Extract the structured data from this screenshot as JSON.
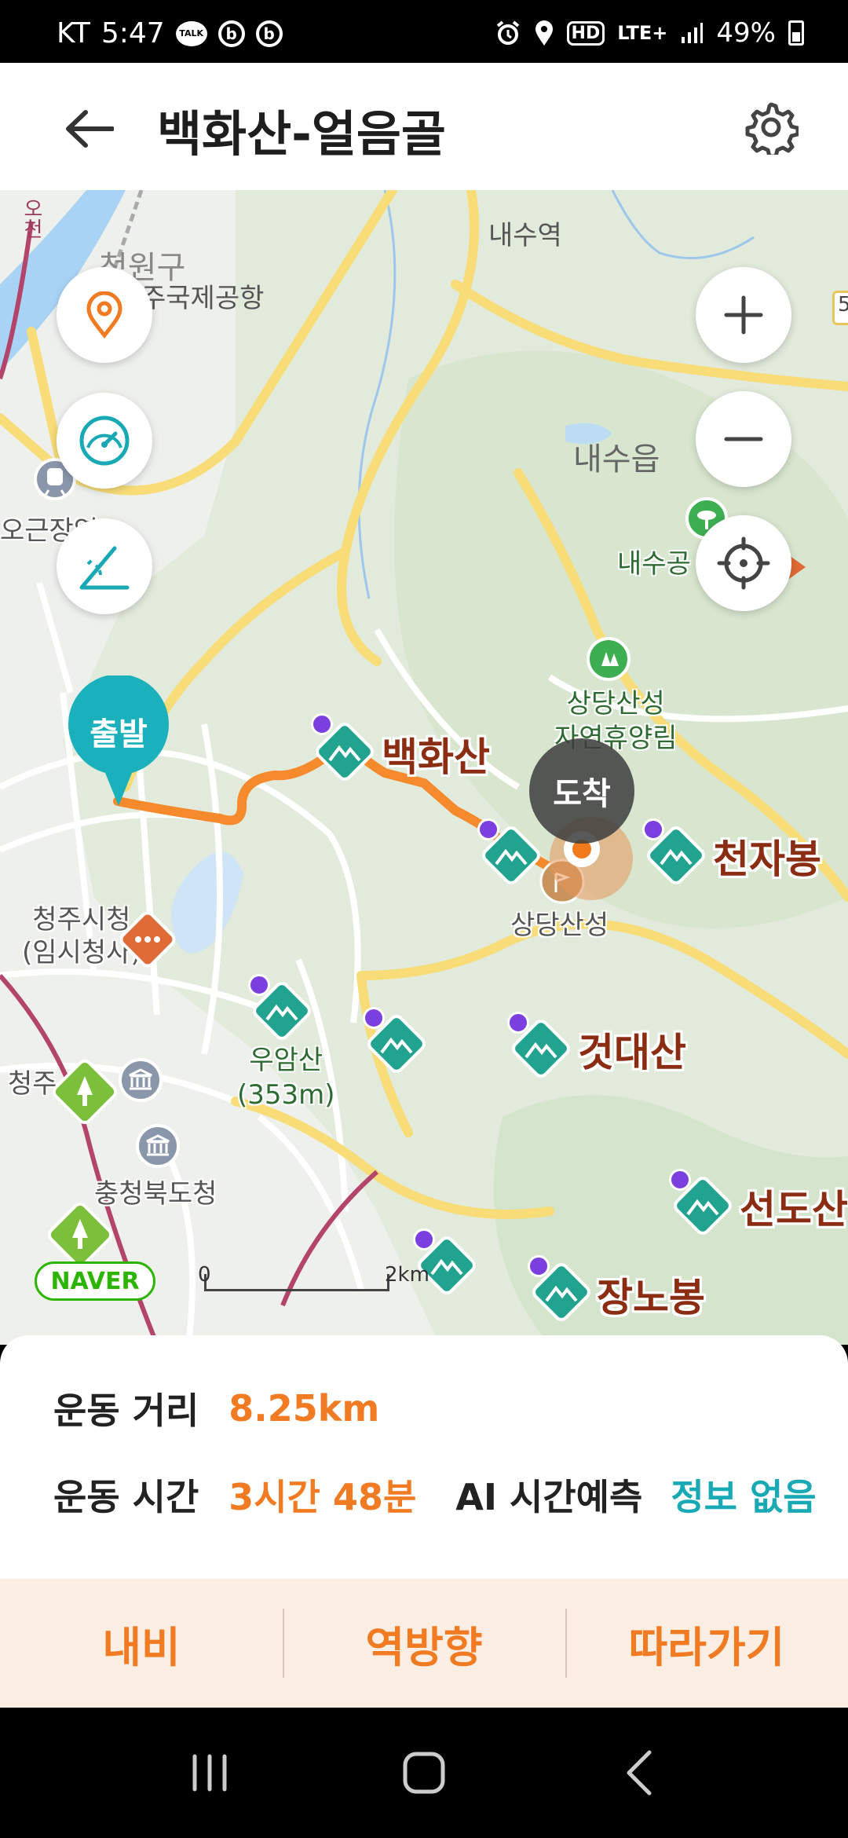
{
  "status_bar": {
    "carrier": "KT",
    "time": "5:47",
    "talk_icon_text": "TALK",
    "b_icon_text": "b",
    "hd_text": "HD",
    "network": "LTE+",
    "battery": "49%"
  },
  "header": {
    "title": "백화산-얼음골"
  },
  "map": {
    "labels": {
      "naesu_station": "내수역",
      "airport_city": "청원구",
      "airport": "주국제공항",
      "oc_river": "오천",
      "ogeunjang": "오근장역",
      "naesu_eup": "내수읍",
      "naesu_park": "내수공",
      "forest_line1": "상당산성",
      "forest_line2": "자연휴양림",
      "sangdang_fortress": "상당산성",
      "city_hall_line1": "청주시청",
      "city_hall_line2": "(임시청사)",
      "cheongju_short": "청주",
      "provincial_office": "충청북도청",
      "uamsan_line1": "우암산",
      "uamsan_line2": "(353m)"
    },
    "peaks": {
      "baekhwasan": "백화산",
      "cheonjabong": "천자봉",
      "geotdaesan": "것대산",
      "seondosan": "선도산",
      "jangnobong": "장노봉"
    },
    "start_label": "출발",
    "end_label": "도착",
    "scale_start": "0",
    "scale_end": "2km",
    "provider_logo": "NAVER",
    "edge_marker": "5"
  },
  "info": {
    "distance_label": "운동 거리",
    "distance_value": "8.25km",
    "time_label": "운동 시간",
    "time_value": "3시간 48분",
    "ai_label": "AI 시간예측",
    "ai_value": "정보 없음"
  },
  "actions": {
    "navi": "내비",
    "reverse": "역방향",
    "follow": "따라가기"
  },
  "colors": {
    "accent_orange": "#f07b22",
    "accent_teal": "#18a9b5",
    "route": "#f58a2c",
    "peak_label": "#8a2d12"
  }
}
